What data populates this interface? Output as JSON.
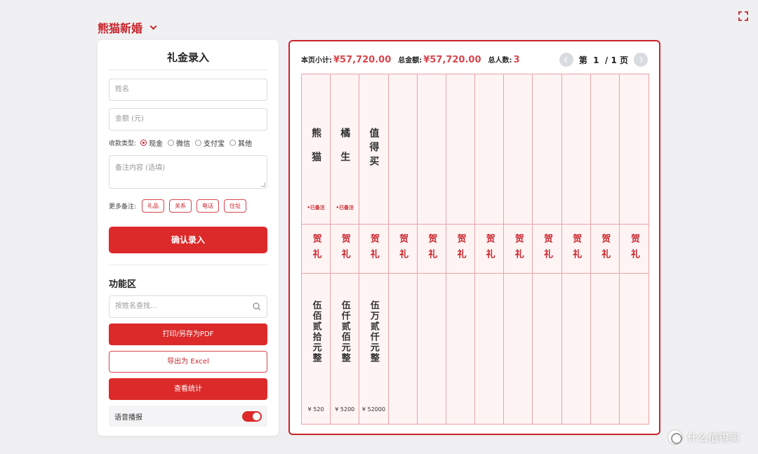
{
  "brand": {
    "title": "熊猫新婚"
  },
  "form": {
    "title": "礼金录入",
    "name_placeholder": "姓名",
    "amount_placeholder": "金额 (元)",
    "pay_label": "收款类型:",
    "pay_options": [
      "现金",
      "微信",
      "支付宝",
      "其他"
    ],
    "pay_selected": "现金",
    "memo_placeholder": "备注内容 (选填)",
    "more_label": "更多备注:",
    "tags": [
      "礼品",
      "关系",
      "电话",
      "住址"
    ],
    "confirm_label": "确认录入"
  },
  "func": {
    "title": "功能区",
    "search_placeholder": "按姓名查找...",
    "print_label": "打印/另存为PDF",
    "excel_label": "导出为 Excel",
    "stats_label": "查看统计",
    "voice_label": "语音播报",
    "voice_on": true
  },
  "summary": {
    "page_subtotal_label": "本页小计:",
    "page_subtotal": "¥57,720.00",
    "total_label": "总金额:",
    "total": "¥57,720.00",
    "count_label": "总人数:",
    "count": "3"
  },
  "pager": {
    "prefix": "第",
    "current": "1",
    "sep": "/",
    "total": "1",
    "suffix": "页"
  },
  "ledger": {
    "greeting": "贺礼",
    "noted_label": "•已备注",
    "entries": [
      {
        "name": "熊猫",
        "amount_text": "伍佰贰拾元整",
        "amount": "¥ 520",
        "noted": true
      },
      {
        "name": "橘生",
        "amount_text": "伍仟贰佰元整",
        "amount": "¥ 5200",
        "noted": true
      },
      {
        "name": "值得买",
        "amount_text": "伍万贰仟元整",
        "amount": "¥ 52000",
        "noted": false
      },
      {
        "name": "",
        "amount_text": "",
        "amount": "",
        "noted": false
      },
      {
        "name": "",
        "amount_text": "",
        "amount": "",
        "noted": false
      },
      {
        "name": "",
        "amount_text": "",
        "amount": "",
        "noted": false
      },
      {
        "name": "",
        "amount_text": "",
        "amount": "",
        "noted": false
      },
      {
        "name": "",
        "amount_text": "",
        "amount": "",
        "noted": false
      },
      {
        "name": "",
        "amount_text": "",
        "amount": "",
        "noted": false
      },
      {
        "name": "",
        "amount_text": "",
        "amount": "",
        "noted": false
      },
      {
        "name": "",
        "amount_text": "",
        "amount": "",
        "noted": false
      },
      {
        "name": "",
        "amount_text": "",
        "amount": "",
        "noted": false
      }
    ]
  },
  "watermark": {
    "text": "什么值得买"
  },
  "colors": {
    "accent": "#dc2a2a",
    "grid_line": "#e9a2a6",
    "grid_bg": "#fff4f4"
  }
}
